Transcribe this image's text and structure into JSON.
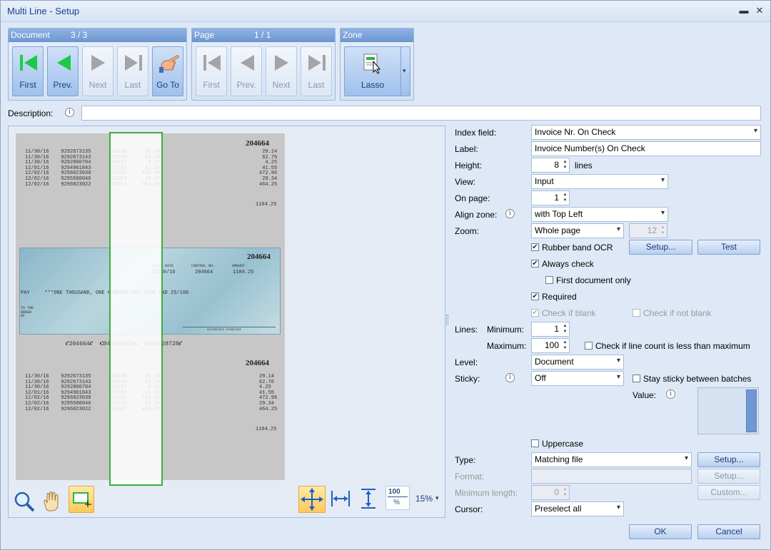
{
  "window": {
    "title": "Multi Line - Setup",
    "minimize_glyph": "▬",
    "close_glyph": "✕"
  },
  "document_group": {
    "title": "Document",
    "counter": "3 / 3",
    "buttons": [
      {
        "label": "First",
        "icon": "first-arrow-icon",
        "state": "on"
      },
      {
        "label": "Prev.",
        "icon": "prev-arrow-icon",
        "state": "on"
      },
      {
        "label": "Next",
        "icon": "next-arrow-icon",
        "state": "off"
      },
      {
        "label": "Last",
        "icon": "last-arrow-icon",
        "state": "off"
      },
      {
        "label": "Go To",
        "icon": "pointing-hand-icon",
        "state": "on"
      }
    ]
  },
  "page_group": {
    "title": "Page",
    "counter": "1 / 1",
    "buttons": [
      {
        "label": "First",
        "icon": "first-arrow-icon",
        "state": "off"
      },
      {
        "label": "Prev.",
        "icon": "prev-arrow-icon",
        "state": "off"
      },
      {
        "label": "Next",
        "icon": "next-arrow-icon",
        "state": "off"
      },
      {
        "label": "Last",
        "icon": "last-arrow-icon",
        "state": "off"
      }
    ]
  },
  "zone_group": {
    "title": "Zone",
    "button_label": "Lasso",
    "dropdown_glyph": "▾"
  },
  "description": {
    "label": "Description:",
    "value": ""
  },
  "info_glyph": "i",
  "document_image": {
    "check_number": "204664",
    "statement_rows": "11/30/16    9292673135      120109      29.14\n11/30/16    9292673143      120236      62.76\n11/30/16    9292800704      120237       4.25\n12/01/16    9294961843      121014      41.55\n12/02/16    9296023030      121015     472.96\n12/02/16    9295500046      121016      29.34\n12/02/16    9296023022      121017     464.25",
    "amounts_right": "29.14\n62.76\n4.25\n41.55\n472.96\n29.34\n464.25",
    "total": "1104.25",
    "cheque": {
      "check_date_label": "CHECK DATE",
      "control_label": "CONTROL NO.",
      "amount_label": "AMOUNT",
      "date": "12/30/16",
      "control": "204664",
      "amount": "1104.25",
      "pay_line": "PAY     ***ONE THOUSAND, ONE HUNDRED AND FOUR AND 25/100",
      "to_order": "TO THE\nORDER\nOF",
      "signature_label": "AUTHORIZED SIGNATURE",
      "micr": "⑈204664⑈  ⑆043301627⑆  1043028728⑈"
    }
  },
  "viewer_toolbar": {
    "zoom_label": "15%",
    "zoom_100_label_top": "100",
    "zoom_100_label_bottom": "%",
    "zoom_dropdown_glyph": "▾"
  },
  "form": {
    "index_field": {
      "label": "Index field:",
      "value": "Invoice Nr. On Check"
    },
    "label_field": {
      "label": "Label:",
      "value": "Invoice Number(s) On Check"
    },
    "height": {
      "label": "Height:",
      "value": "8",
      "unit": "lines"
    },
    "view": {
      "label": "View:",
      "value": "Input"
    },
    "on_page": {
      "label": "On page:",
      "value": "1"
    },
    "align_zone": {
      "label": "Align zone:",
      "value": "with Top Left"
    },
    "zoom": {
      "label": "Zoom:",
      "value": "Whole page",
      "spin_value": "12"
    },
    "rubber_band": {
      "label": "Rubber band OCR",
      "checked": true,
      "setup_label": "Setup...",
      "test_label": "Test"
    },
    "always_check": {
      "label": "Always check",
      "checked": true
    },
    "first_doc_only": {
      "label": "First document only",
      "checked": false
    },
    "required": {
      "label": "Required",
      "checked": true
    },
    "check_if_blank": {
      "label": "Check if blank",
      "checked": true
    },
    "check_if_not_blank": {
      "label": "Check if not blank",
      "checked": false
    },
    "lines": {
      "label": "Lines:",
      "min_label": "Minimum:",
      "min_value": "1",
      "max_label": "Maximum:",
      "max_value": "100",
      "less_label": "Check if line count is less than maximum"
    },
    "level": {
      "label": "Level:",
      "value": "Document"
    },
    "sticky": {
      "label": "Sticky:",
      "value": "Off",
      "stay_label": "Stay sticky between batches"
    },
    "value": {
      "label": "Value:"
    },
    "uppercase": {
      "label": "Uppercase"
    },
    "type": {
      "label": "Type:",
      "value": "Matching file",
      "setup_label": "Setup..."
    },
    "format": {
      "label": "Format:",
      "value": "",
      "setup_label": "Setup..."
    },
    "min_length": {
      "label": "Minimum length:",
      "value": "0",
      "custom_label": "Custom..."
    },
    "cursor": {
      "label": "Cursor:",
      "value": "Preselect all"
    },
    "check_glyph": "✔",
    "spin_up": "▲",
    "spin_down": "▼"
  },
  "dialog": {
    "ok_label": "OK",
    "cancel_label": "Cancel"
  },
  "colors": {
    "accent": "#6f98d3",
    "zone_outline": "#3ab03a",
    "arrow_green": "#1ec94a"
  }
}
